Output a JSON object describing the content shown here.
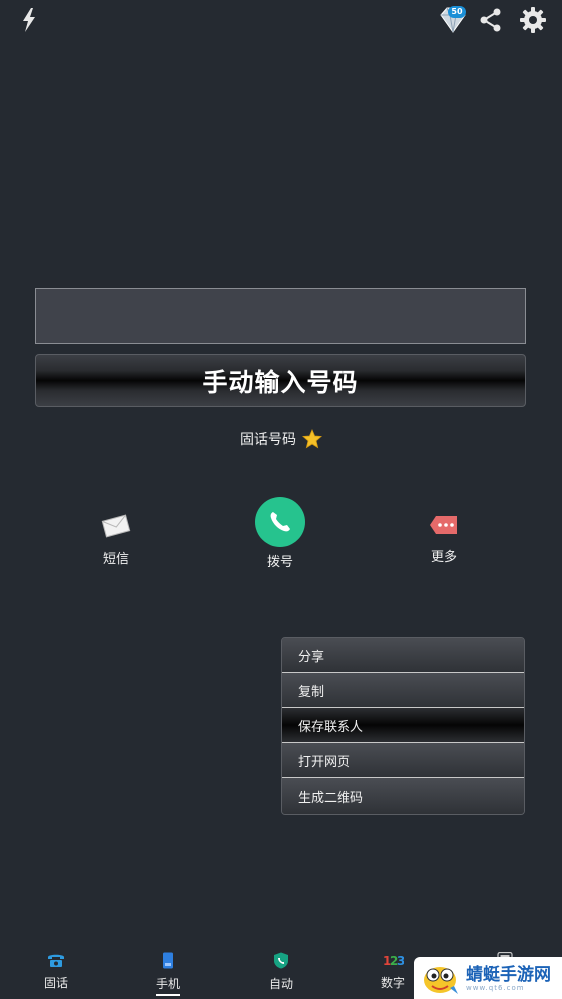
{
  "topbar": {
    "flash_icon": "lightning-icon",
    "gem_badge": "50",
    "share_icon": "share-icon",
    "settings_icon": "gear-icon"
  },
  "display": {
    "number_value": "",
    "manual_entry_label": "手动输入号码",
    "number_type_label": "固话号码"
  },
  "actions": [
    {
      "label": "短信",
      "icon": "envelope-icon"
    },
    {
      "label": "拨号",
      "icon": "phone-icon"
    },
    {
      "label": "更多",
      "icon": "more-tag-icon"
    }
  ],
  "context_menu": {
    "items": [
      {
        "label": "分享"
      },
      {
        "label": "复制"
      },
      {
        "label": "保存联系人"
      },
      {
        "label": "打开网页"
      },
      {
        "label": "生成二维码"
      }
    ],
    "highlighted_index": 2
  },
  "bottom_nav": {
    "tabs": [
      {
        "label": "固话",
        "icon": "landline-phone-icon"
      },
      {
        "label": "手机",
        "icon": "mobile-phone-icon"
      },
      {
        "label": "自动",
        "icon": "auto-shield-icon"
      },
      {
        "label": "数字",
        "icon": "numbers-123-icon"
      },
      {
        "label": "",
        "icon": "calculator-icon"
      }
    ],
    "selected_index": 1
  },
  "watermark": {
    "text": "蜻蜓手游网",
    "sub": "www.qt6.com"
  },
  "colors": {
    "background": "#252a31",
    "dial_green": "#26c38e",
    "accent_blue": "#1b8fd6"
  }
}
